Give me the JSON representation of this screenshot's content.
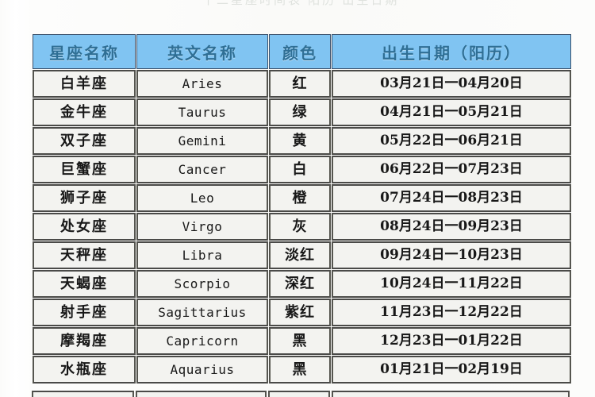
{
  "page": {
    "top_cut_text": "十二星座时间表  阳历  出生日期",
    "accent_header_bg": "#80c4f2",
    "header_text_color": "#2f6f95",
    "cell_bg": "#f3f3f0",
    "border_color": "#4a4a48"
  },
  "table": {
    "columns": [
      {
        "key": "name",
        "label": "星座名称"
      },
      {
        "key": "en",
        "label": "英文名称"
      },
      {
        "key": "color",
        "label": "颜色"
      },
      {
        "key": "date",
        "label": "出生日期（阳历）"
      }
    ],
    "rows": [
      {
        "name": "白羊座",
        "en": "Aries",
        "color": "红",
        "date": "03月21日一04月20日"
      },
      {
        "name": "金牛座",
        "en": "Taurus",
        "color": "绿",
        "date": "04月21日一05月21日"
      },
      {
        "name": "双子座",
        "en": "Gemini",
        "color": "黄",
        "date": "05月22日一06月21日"
      },
      {
        "name": "巨蟹座",
        "en": "Cancer",
        "color": "白",
        "date": "06月22日一07月23日"
      },
      {
        "name": "狮子座",
        "en": "Leo",
        "color": "橙",
        "date": "07月24日一08月23日"
      },
      {
        "name": "处女座",
        "en": "Virgo",
        "color": "灰",
        "date": "08月24日一09月23日"
      },
      {
        "name": "天秤座",
        "en": "Libra",
        "color": "淡红",
        "date": "09月24日一10月23日"
      },
      {
        "name": "天蝎座",
        "en": "Scorpio",
        "color": "深红",
        "date": "10月24日一11月22日"
      },
      {
        "name": "射手座",
        "en": "Sagittarius",
        "color": "紫红",
        "date": "11月23日一12月22日"
      },
      {
        "name": "摩羯座",
        "en": "Capricorn",
        "color": "黑",
        "date": "12月23日一01月22日"
      },
      {
        "name": "水瓶座",
        "en": "Aquarius",
        "color": "黑",
        "date": "01月21日一02月19日"
      }
    ]
  }
}
